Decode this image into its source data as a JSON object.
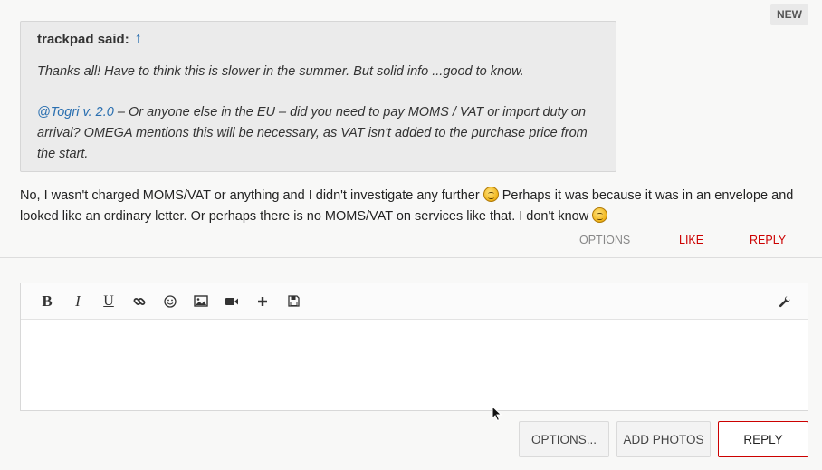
{
  "badge": {
    "label": "NEW"
  },
  "quote": {
    "author": "trackpad said:",
    "paragraph1": "Thanks all! Have to think this is slower in the summer. But solid info ...good to know.",
    "mention": "@Togri v. 2.0",
    "paragraph2": " – Or anyone else in the EU – did you need to pay MOMS / VAT or import duty on arrival? OMEGA mentions this will be necessary, as VAT isn't added to the purchase price from the start."
  },
  "reply": {
    "part1": "No, I wasn't charged MOMS/VAT or anything and I didn't investigate any further ",
    "part2": " Perhaps it was because it was in an envelope and looked like an ordinary letter. Or perhaps there is no MOMS/VAT on services like that. I don't know "
  },
  "post_actions": {
    "options": "OPTIONS",
    "like": "LIKE",
    "reply": "REPLY"
  },
  "editor": {
    "toolbar": {
      "bold": "B",
      "italic": "I",
      "underline": "U"
    }
  },
  "buttons": {
    "options": "OPTIONS...",
    "add_photos": "ADD PHOTOS",
    "reply": "REPLY"
  },
  "colors": {
    "accent": "#cc0000",
    "link": "#2a6fb0"
  }
}
